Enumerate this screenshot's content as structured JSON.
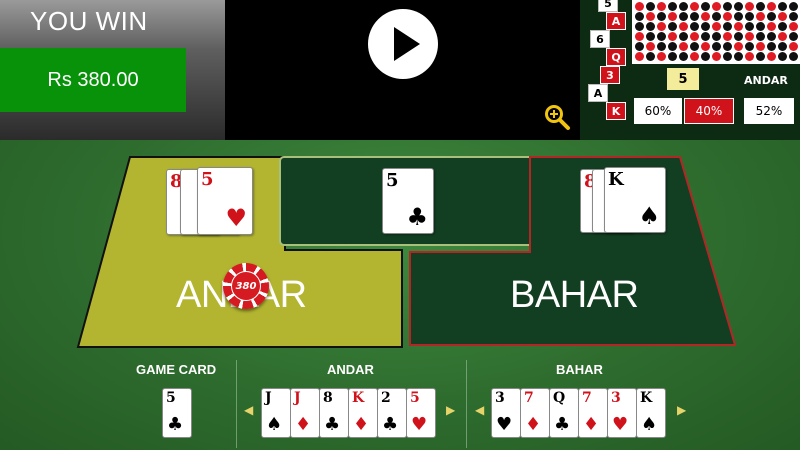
{
  "win": {
    "title": "YOU WIN",
    "amount": "Rs 380.00"
  },
  "history": {
    "cards": [
      {
        "text": "5",
        "style": "white"
      },
      {
        "text": "A",
        "style": "red"
      },
      {
        "text": "6",
        "style": "white"
      },
      {
        "text": "Q",
        "style": "red"
      },
      {
        "text": "3",
        "style": "red"
      },
      {
        "text": "A",
        "style": "white"
      },
      {
        "text": "K",
        "style": "red"
      }
    ],
    "current_number": "5",
    "andar_header": "ANDAR",
    "percentages": [
      "60%",
      "40%",
      "52%"
    ]
  },
  "table": {
    "andar_label": "ANDAR",
    "bahar_label": "BAHAR",
    "chip_value": "380",
    "game_card": {
      "rank": "5",
      "suit": "♣",
      "color": "black"
    },
    "andar_top": [
      {
        "rank": "8",
        "suit": "",
        "color": "red"
      },
      {
        "rank": "5",
        "suit": "♥",
        "color": "red"
      }
    ],
    "bahar_top": [
      {
        "rank": "8",
        "suit": "",
        "color": "red"
      },
      {
        "rank": "K",
        "suit": "♠",
        "color": "black"
      }
    ]
  },
  "strip": {
    "game_card_label": "GAME CARD",
    "andar_label": "ANDAR",
    "bahar_label": "BAHAR",
    "game_card": {
      "rank": "5",
      "suit": "♣",
      "color": "black"
    },
    "andar_cards": [
      {
        "rank": "J",
        "suit": "♠",
        "color": "black"
      },
      {
        "rank": "J",
        "suit": "♦",
        "color": "red"
      },
      {
        "rank": "8",
        "suit": "♣",
        "color": "black"
      },
      {
        "rank": "K",
        "suit": "♦",
        "color": "red"
      },
      {
        "rank": "2",
        "suit": "♣",
        "color": "black"
      },
      {
        "rank": "5",
        "suit": "♥",
        "color": "red"
      }
    ],
    "bahar_cards": [
      {
        "rank": "3",
        "suit": "♥",
        "color": "black"
      },
      {
        "rank": "7",
        "suit": "♦",
        "color": "red"
      },
      {
        "rank": "Q",
        "suit": "♣",
        "color": "black"
      },
      {
        "rank": "7",
        "suit": "♦",
        "color": "red"
      },
      {
        "rank": "3",
        "suit": "♥",
        "color": "red"
      },
      {
        "rank": "K",
        "suit": "♠",
        "color": "black"
      }
    ]
  },
  "colors": {
    "andar_zone": "#b5b531",
    "bahar_zone": "#123f22",
    "win_green": "#07920a",
    "pct_red": "#d0121b"
  },
  "icons": {
    "play": "play-icon",
    "zoom": "zoom-in-icon"
  }
}
